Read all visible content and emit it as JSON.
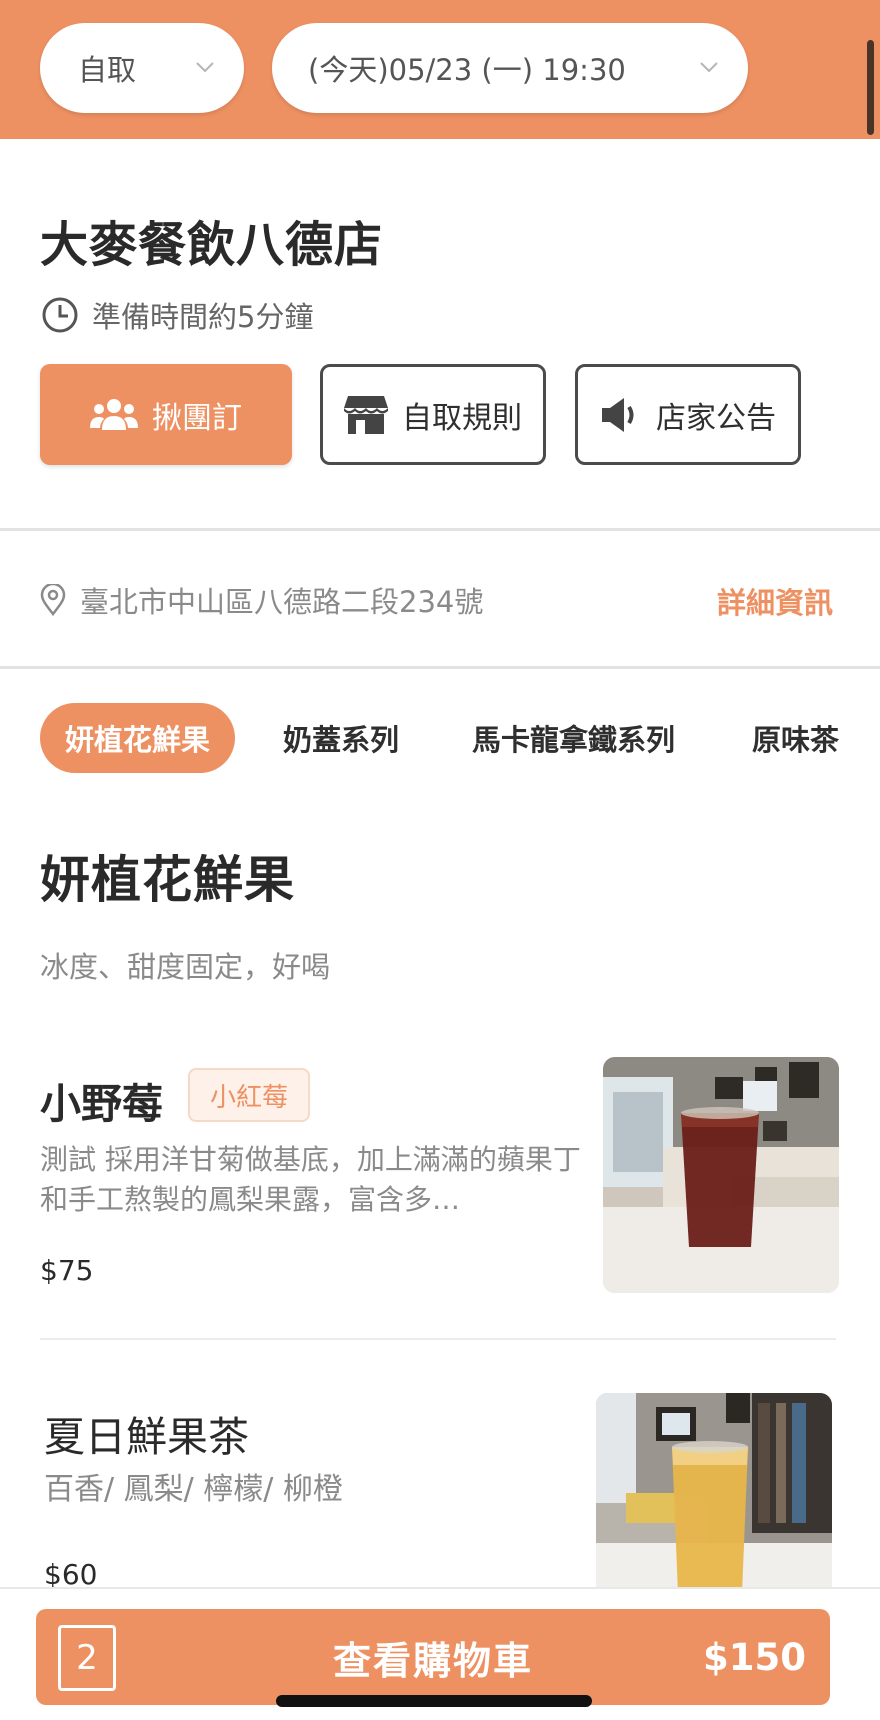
{
  "header": {
    "mode_value": "自取",
    "pickup_time_value": "(今天)05/23 (一) 19:30"
  },
  "store": {
    "name": "大麥餐飲八德店",
    "prep_time": "準備時間約5分鐘",
    "actions": {
      "group_order": "揪團訂",
      "pickup_rules": "自取規則",
      "announcement": "店家公告"
    },
    "address": "臺北市中山區八德路二段234號",
    "detail_link": "詳細資訊"
  },
  "categories": {
    "tabs": [
      "妍植花鮮果",
      "奶蓋系列",
      "馬卡龍拿鐵系列",
      "原味茶"
    ],
    "active_index": 0
  },
  "section": {
    "title": "妍植花鮮果",
    "description": "冰度、甜度固定，好喝"
  },
  "items": [
    {
      "name": "小野莓",
      "tag": "小紅莓",
      "description": "測試 採用洋甘菊做基底，加上滿滿的蘋果丁和手工熬製的鳳梨果露，富含多…",
      "price": "$75"
    },
    {
      "name": "夏日鮮果茶",
      "description": "百香/ 鳳梨/ 檸檬/ 柳橙",
      "price": "$60"
    }
  ],
  "cart": {
    "count": "2",
    "label": "查看購物車",
    "total": "$150"
  },
  "colors": {
    "brand": "#ee9162",
    "border_dark": "#4b4b4b",
    "text_muted": "#8a8a8a"
  },
  "icons": [
    "chevron-down-icon",
    "clock-icon",
    "group-icon",
    "store-icon",
    "megaphone-icon",
    "location-pin-icon"
  ]
}
